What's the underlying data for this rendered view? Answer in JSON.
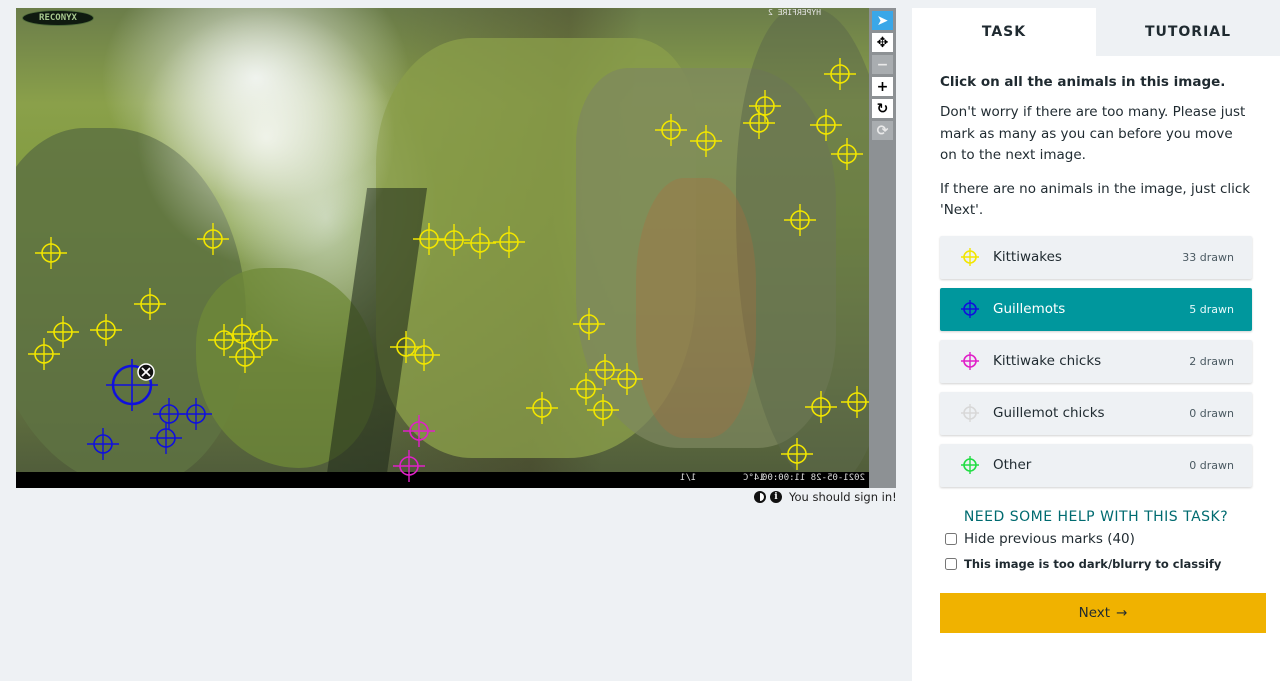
{
  "viewer": {
    "logo_text": "RECONYX",
    "camera_top_text": "HYPERFIRE 2",
    "camera_strip": {
      "datetime": "2021-05-28 11:00:00",
      "temperature": "14°C",
      "frame": "1/1"
    },
    "tools": [
      {
        "name": "pointer-tool",
        "icon": "arrow-pointer-icon",
        "glyph": "➤",
        "state": "active"
      },
      {
        "name": "move-tool",
        "icon": "move-icon",
        "glyph": "✥",
        "state": "normal"
      },
      {
        "name": "zoom-out-tool",
        "icon": "minus-icon",
        "glyph": "−",
        "state": "disabled"
      },
      {
        "name": "zoom-in-tool",
        "icon": "plus-icon",
        "glyph": "+",
        "state": "normal"
      },
      {
        "name": "rotate-tool",
        "icon": "rotate-icon",
        "glyph": "↻",
        "state": "normal"
      },
      {
        "name": "reset-tool",
        "icon": "refresh-icon",
        "glyph": "⟳",
        "state": "disabled"
      }
    ],
    "signin_text": "You should sign in!"
  },
  "tabs": [
    {
      "label": "TASK",
      "active": true
    },
    {
      "label": "TUTORIAL",
      "active": false
    }
  ],
  "task": {
    "question": "Click on all the animals in this image.",
    "paragraphs": [
      "Don't worry if there are too many. Please just mark as many as you can before you move on to the next image.",
      "If there are no animals in the image, just click 'Next'."
    ],
    "choices": [
      {
        "label": "Kittiwakes",
        "count": "33 drawn",
        "color": "#f2e600",
        "selected": false
      },
      {
        "label": "Guillemots",
        "count": "5 drawn",
        "color": "#1010dd",
        "selected": true
      },
      {
        "label": "Kittiwake chicks",
        "count": "2 drawn",
        "color": "#e020c8",
        "selected": false
      },
      {
        "label": "Guillemot chicks",
        "count": "0 drawn",
        "color": "#d8d8d8",
        "selected": false
      },
      {
        "label": "Other",
        "count": "0 drawn",
        "color": "#22dd44",
        "selected": false
      }
    ],
    "help_text": "NEED SOME HELP WITH THIS TASK?",
    "hide_marks_label": "Hide previous marks (40)",
    "dark_label": "This image is too dark/blurry to classify",
    "next_label": "Next",
    "next_arrow": "→"
  },
  "marks": {
    "kittiwake_color": "#f2e600",
    "guillemot_color": "#1010dd",
    "chick_color": "#e020c8"
  }
}
